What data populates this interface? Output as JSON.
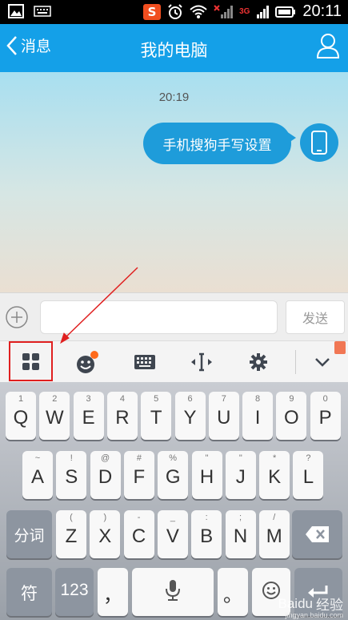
{
  "status_bar": {
    "time": "20:11",
    "network": "3G"
  },
  "header": {
    "back_label": "消息",
    "title": "我的电脑"
  },
  "chat": {
    "timestamp": "20:19",
    "message": "手机搜狗手写设置"
  },
  "input_bar": {
    "send_label": "发送",
    "placeholder": ""
  },
  "toolbar": {
    "items": [
      "grid-menu-icon",
      "emoji-icon",
      "keyboard-icon",
      "cursor-move-icon",
      "settings-icon",
      "collapse-chevron-icon"
    ],
    "notification_dot_color": "#ff6a1a"
  },
  "keyboard": {
    "row1": [
      {
        "hint": "1",
        "key": "Q"
      },
      {
        "hint": "2",
        "key": "W"
      },
      {
        "hint": "3",
        "key": "E"
      },
      {
        "hint": "4",
        "key": "R"
      },
      {
        "hint": "5",
        "key": "T"
      },
      {
        "hint": "6",
        "key": "Y"
      },
      {
        "hint": "7",
        "key": "U"
      },
      {
        "hint": "8",
        "key": "I"
      },
      {
        "hint": "9",
        "key": "O"
      },
      {
        "hint": "0",
        "key": "P"
      }
    ],
    "row2": [
      {
        "hint": "~",
        "key": "A"
      },
      {
        "hint": "!",
        "key": "S"
      },
      {
        "hint": "@",
        "key": "D"
      },
      {
        "hint": "#",
        "key": "F"
      },
      {
        "hint": "%",
        "key": "G"
      },
      {
        "hint": "\"",
        "key": "H"
      },
      {
        "hint": "\"",
        "key": "J"
      },
      {
        "hint": "*",
        "key": "K"
      },
      {
        "hint": "?",
        "key": "L"
      }
    ],
    "row3": [
      {
        "hint": "(",
        "key": "Z"
      },
      {
        "hint": ")",
        "key": "X"
      },
      {
        "hint": "-",
        "key": "C"
      },
      {
        "hint": "_",
        "key": "V"
      },
      {
        "hint": ":",
        "key": "B"
      },
      {
        "hint": ";",
        "key": "N"
      },
      {
        "hint": "/",
        "key": "M"
      }
    ],
    "segment_label": "分词",
    "symbol_label": "符",
    "number_label": "123",
    "comma": "，",
    "period": "。"
  },
  "watermark": {
    "brand": "Baidu",
    "suffix": "经验",
    "url": "jingyan.baidu.com"
  },
  "colors": {
    "header": "#14a0e8",
    "bubble": "#1e9cda",
    "highlight": "#e02020"
  }
}
